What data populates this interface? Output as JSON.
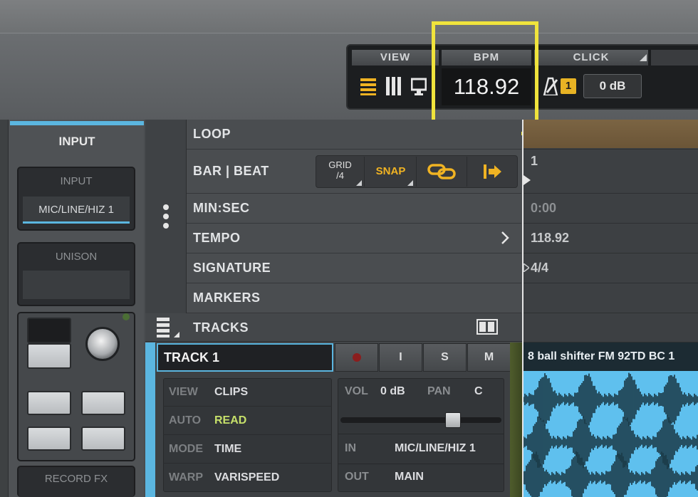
{
  "transport": {
    "view_label": "VIEW",
    "bpm_label": "BPM",
    "bpm_value": "118.92",
    "click_label": "CLICK",
    "click_badge": "1",
    "click_level": "0 dB"
  },
  "input_panel": {
    "title": "INPUT",
    "input_label": "INPUT",
    "input_value": "MIC/LINE/HIZ 1",
    "unison_label": "UNISON",
    "record_fx_label": "RECORD FX"
  },
  "ruler": {
    "loop": "LOOP",
    "bar_beat": "BAR | BEAT",
    "min_sec": "MIN:SEC",
    "tempo": "TEMPO",
    "signature": "SIGNATURE",
    "markers": "MARKERS",
    "grid_label": "GRID",
    "grid_value": "/4",
    "snap_label": "SNAP",
    "bar_number": "1",
    "time_value": "0:00",
    "tempo_value": "118.92",
    "signature_value": "4/4"
  },
  "tracks": {
    "header_label": "TRACKS",
    "track": {
      "name": "TRACK 1",
      "btn_i": "I",
      "btn_s": "S",
      "btn_m": "M",
      "info": [
        {
          "key": "VIEW",
          "value": "CLIPS"
        },
        {
          "key": "AUTO",
          "value": "READ"
        },
        {
          "key": "MODE",
          "value": "TIME"
        },
        {
          "key": "WARP",
          "value": "VARISPEED"
        }
      ],
      "vol_label": "VOL",
      "vol_value": "0 dB",
      "pan_label": "PAN",
      "pan_value": "C",
      "in_label": "IN",
      "in_value": "MIC/LINE/HIZ 1",
      "out_label": "OUT",
      "out_value": "MAIN",
      "fader_level": 0.72,
      "clip_name": "8 ball shifter FM 92TD BC 1"
    }
  },
  "colors": {
    "accent_blue": "#5bb6e0",
    "highlight_yellow": "#f0e33c",
    "auto_read_green": "#c6e06a",
    "snap_orange": "#f0b323",
    "record_red": "#8b1e1e"
  }
}
